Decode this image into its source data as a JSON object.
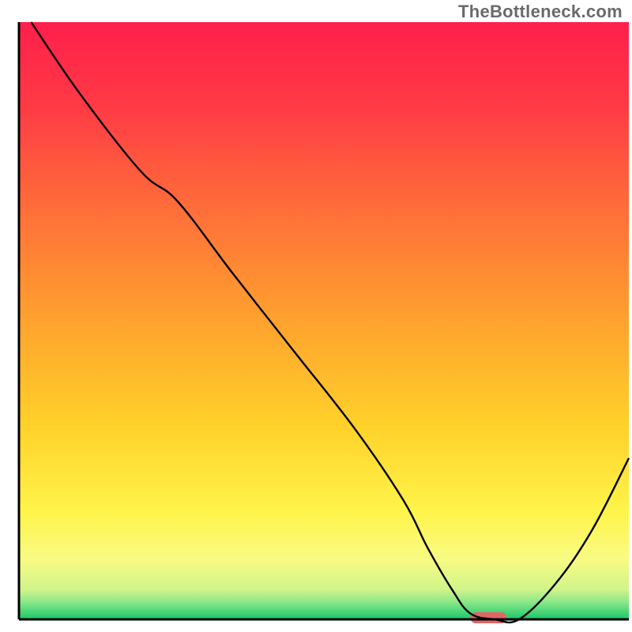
{
  "watermark": "TheBottleneck.com",
  "chart_data": {
    "type": "line",
    "title": "",
    "xlabel": "",
    "ylabel": "",
    "xlim": [
      0,
      100
    ],
    "ylim": [
      0,
      100
    ],
    "x": [
      2,
      10,
      20,
      26,
      35,
      45,
      55,
      63,
      67,
      71,
      74,
      78,
      82,
      88,
      94,
      100
    ],
    "values": [
      100,
      88,
      75,
      70,
      58,
      45,
      32,
      20,
      12,
      5,
      1,
      0,
      0,
      6,
      15,
      27
    ],
    "marker": {
      "x_start": 74,
      "x_end": 80,
      "y": 0
    },
    "gradient_stops": [
      {
        "pct": 0,
        "color": "#ff1f4b"
      },
      {
        "pct": 14,
        "color": "#ff3a45"
      },
      {
        "pct": 30,
        "color": "#ff6a3a"
      },
      {
        "pct": 50,
        "color": "#ffa22e"
      },
      {
        "pct": 68,
        "color": "#ffd22a"
      },
      {
        "pct": 82,
        "color": "#fff44a"
      },
      {
        "pct": 90,
        "color": "#f8fb83"
      },
      {
        "pct": 95,
        "color": "#d0f48a"
      },
      {
        "pct": 97,
        "color": "#8fe889"
      },
      {
        "pct": 100,
        "color": "#17c96a"
      }
    ],
    "axis_color": "#000000",
    "marker_color": "#e06666"
  }
}
